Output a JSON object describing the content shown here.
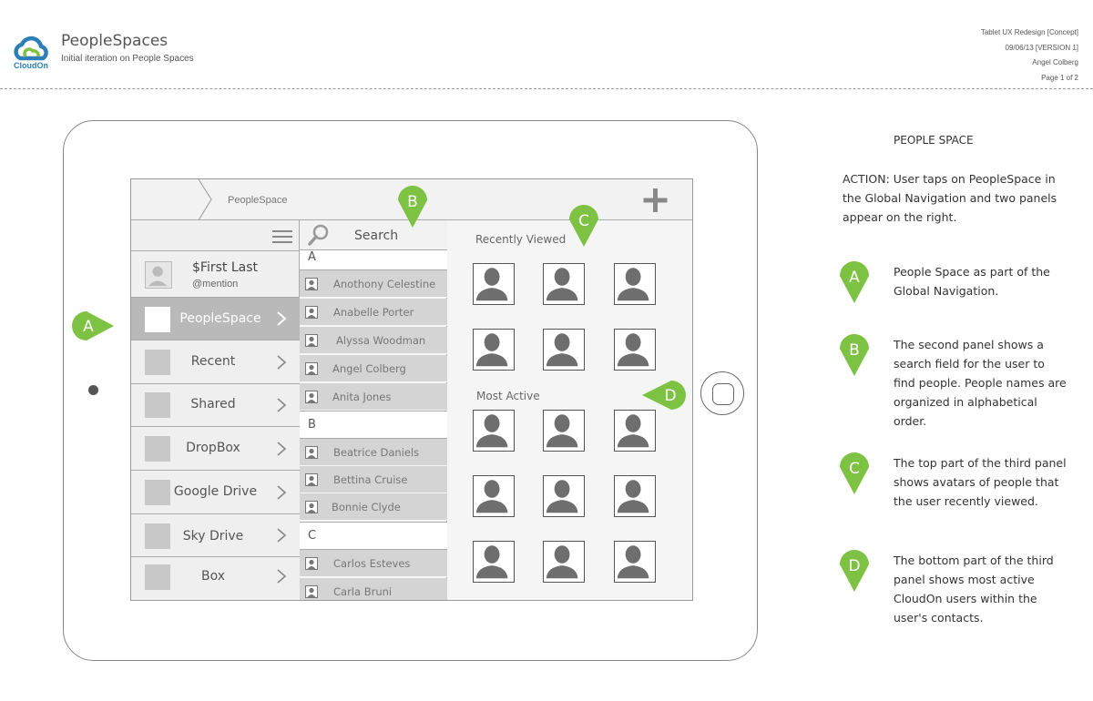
{
  "header": {
    "logo_text": "CloudOn",
    "title": "PeopleSpaces",
    "subtitle": "Initial iteration on People Spaces",
    "meta": [
      "Tablet UX Redesign [Concept]",
      "09/06/13 [VERSION 1]",
      "Angel Colberg",
      "Page 1 of 2"
    ]
  },
  "screen": {
    "breadcrumb": "PeopleSpace",
    "profile": {
      "name": "$First  Last",
      "mention": "@mention"
    },
    "nav": [
      {
        "label": "PeopleSpace",
        "active": true
      },
      {
        "label": "Recent"
      },
      {
        "label": "Shared"
      },
      {
        "label": "DropBox"
      },
      {
        "label": "Google Drive"
      },
      {
        "label": "Sky Drive"
      },
      {
        "label": "Box"
      }
    ],
    "search_label": "Search",
    "letters": [
      "A",
      "B",
      "C"
    ],
    "people": [
      "Anothony Celestine",
      "Anabelle Porter",
      "Alyssa Woodman",
      "Angel Colberg",
      "Anita Jones",
      "Beatrice Daniels",
      "Bettina Cruise",
      "Bonnie Clyde",
      "Carlos Esteves",
      "Carla Bruni"
    ],
    "recently_viewed_title": "Recently Viewed",
    "most_active_title": "Most Active"
  },
  "markers": [
    "A",
    "B",
    "C",
    "D"
  ],
  "annotations": {
    "title": "PEOPLE SPACE",
    "action": "ACTION: User taps on PeopleSpace in the Global Navigation and two panels appear on the right.",
    "items": [
      {
        "letter": "A",
        "text": "People Space as part of the Global Navigation."
      },
      {
        "letter": "B",
        "text": "The second panel shows a search field for the user to find people. People names are organized in alphabetical order."
      },
      {
        "letter": "C",
        "text": "The top part of the third panel shows avatars of people that the user recently viewed."
      },
      {
        "letter": "D",
        "text": "The bottom part of the third panel shows most active CloudOn users within the user's contacts."
      }
    ]
  },
  "colors": {
    "accent_green": "#7dc242",
    "logo_blue": "#2d7fb8",
    "logo_green": "#7dc242"
  }
}
